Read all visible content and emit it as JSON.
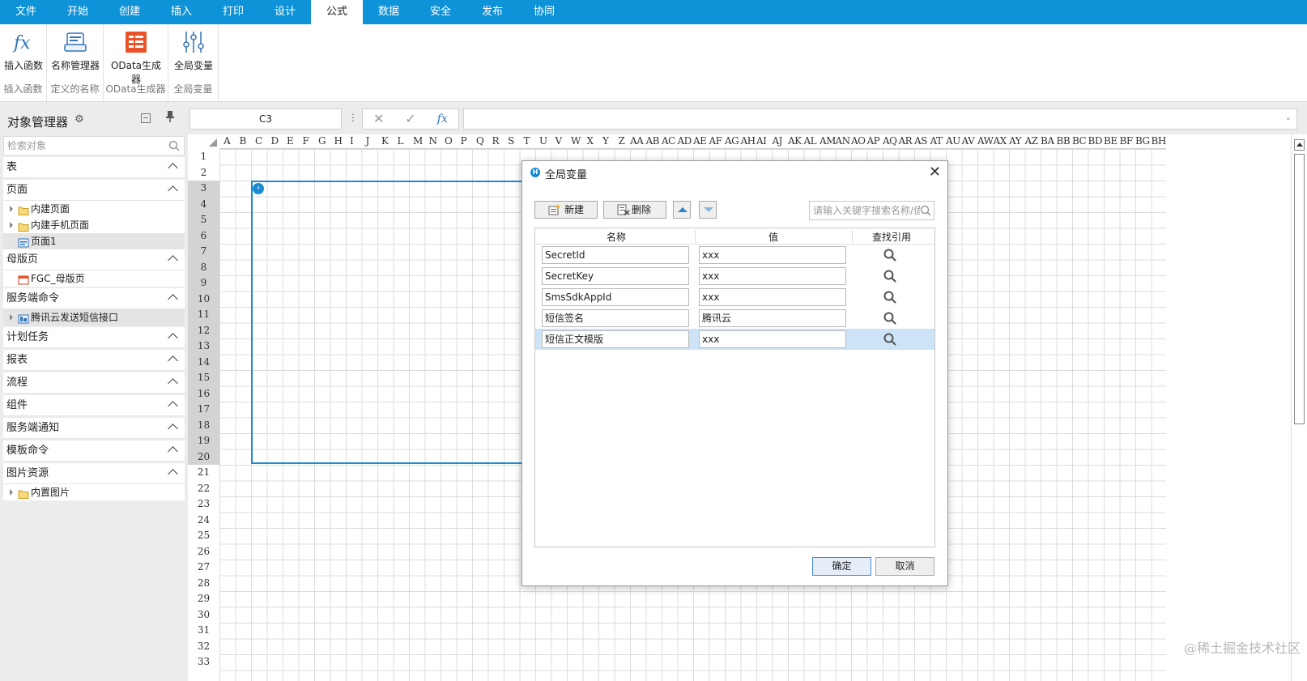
{
  "menu": {
    "tabs": [
      "文件",
      "开始",
      "创建",
      "插入",
      "打印",
      "设计",
      "公式",
      "数据",
      "安全",
      "发布",
      "协同"
    ],
    "active": "公式"
  },
  "ribbon": {
    "buttons": [
      "插入函数",
      "名称管理器",
      "OData生成器",
      "全局变量"
    ],
    "captions": [
      "插入函数",
      "定义的名称",
      "OData生成器",
      "全局变量"
    ]
  },
  "left_panel": {
    "title": "对象管理器",
    "search_placeholder": "检索对象",
    "sections": {
      "table": "表",
      "page": "页面",
      "page_items": [
        "内建页面",
        "内建手机页面",
        "页面1"
      ],
      "master": "母版页",
      "master_items": [
        "FGC_母版页"
      ],
      "server_cmd": "服务端命令",
      "server_cmd_items": [
        "腾讯云发送短信接口"
      ],
      "scheduled": "计划任务",
      "report": "报表",
      "flow": "流程",
      "component": "组件",
      "server_notify": "服务端通知",
      "template_cmd": "模板命令",
      "image_res": "图片资源",
      "image_items": [
        "内置图片"
      ]
    }
  },
  "formula_bar": {
    "cell_ref": "C3",
    "cancel": "✕",
    "confirm": "✓",
    "fx": "fx",
    "expand": "⌄",
    "separator": "⋮"
  },
  "sheet": {
    "columns": [
      "A",
      "B",
      "C",
      "D",
      "E",
      "F",
      "G",
      "H",
      "I",
      "J",
      "K",
      "L",
      "M",
      "N",
      "O",
      "P",
      "Q",
      "R",
      "S",
      "T",
      "U",
      "V",
      "W",
      "X",
      "Y",
      "Z",
      "AA",
      "AB",
      "AC",
      "AD",
      "AE",
      "AF",
      "AG",
      "AH",
      "AI",
      "AJ",
      "AK",
      "AL",
      "AM",
      "AN",
      "AO",
      "AP",
      "AQ",
      "AR",
      "AS",
      "AT",
      "AU",
      "AV",
      "AW",
      "AX",
      "AY",
      "AZ",
      "BA",
      "BB",
      "BC",
      "BD",
      "BE",
      "BF",
      "BG",
      "BH"
    ],
    "rows": 33,
    "selected_rows_from": 3,
    "selected_rows_to": 20
  },
  "dialog": {
    "title": "全局变量",
    "close": "✕",
    "new_label": "新建",
    "delete_label": "删除",
    "search_placeholder": "请输入关键字搜索名称/值",
    "col_name": "名称",
    "col_value": "值",
    "col_ref": "查找引用",
    "rows": [
      {
        "name": "SecretId",
        "value": "xxx"
      },
      {
        "name": "SecretKey",
        "value": "xxx"
      },
      {
        "name": "SmsSdkAppId",
        "value": "xxx"
      },
      {
        "name": "短信签名",
        "value": "腾讯云"
      },
      {
        "name": "短信正文模版",
        "value": "xxx"
      }
    ],
    "selected_row": 4,
    "ok_label": "确定",
    "cancel_label": "取消"
  },
  "watermark": "@稀土掘金技术社区",
  "colors": {
    "menu_bg": "#0f93d8",
    "accent": "#1a8bd0",
    "selected_row": "#cde4f7"
  }
}
